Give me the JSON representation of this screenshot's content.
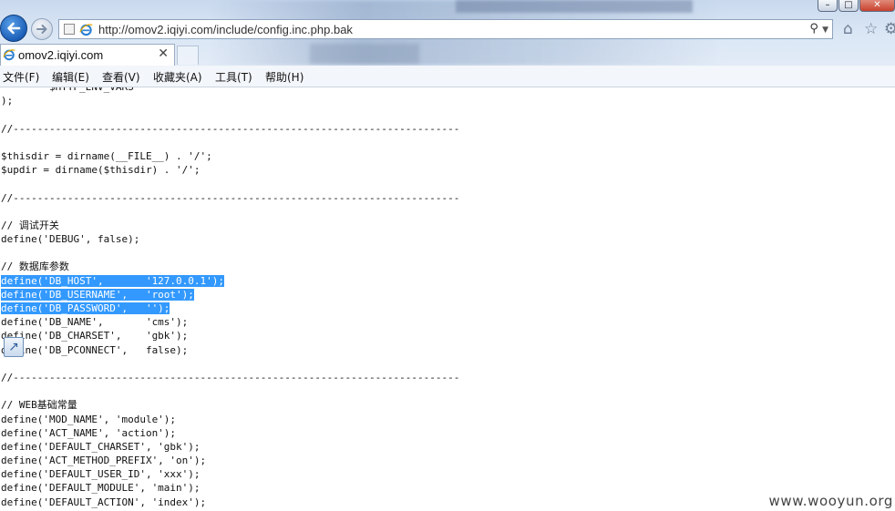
{
  "browser": {
    "url": "http://omov2.iqiyi.com/include/config.inc.php.bak",
    "tab_title": "omov2.iqiyi.com",
    "tab_close": "✕",
    "search_glyph": "⚲",
    "menu": [
      "文件(F)",
      "编辑(E)",
      "查看(V)",
      "收藏夹(A)",
      "工具(T)",
      "帮助(H)"
    ],
    "window_buttons": [
      "–",
      "□",
      "✕"
    ],
    "toolbar_icons": [
      "home-icon",
      "favorites-star-icon",
      "tools-gear-icon"
    ]
  },
  "code_lines": [
    {
      "text": "        $HTTP_ENV_VARS"
    },
    {
      "text": ");"
    },
    {
      "text": ""
    },
    {
      "text": "//--------------------------------------------------------------------------"
    },
    {
      "text": ""
    },
    {
      "text": "$thisdir = dirname(__FILE__) . '/';"
    },
    {
      "text": "$updir = dirname($thisdir) . '/';"
    },
    {
      "text": ""
    },
    {
      "text": "//--------------------------------------------------------------------------"
    },
    {
      "text": ""
    },
    {
      "text": "// 调试开关"
    },
    {
      "text": "define('DEBUG', false);"
    },
    {
      "text": ""
    },
    {
      "text": "// 数据库参数"
    },
    {
      "text": "define('DB_HOST',       '127.0.0.1');",
      "selected": true
    },
    {
      "text": "define('DB_USERNAME',   'root');",
      "selected": true
    },
    {
      "text": "define('DB_PASSWORD',   '');",
      "selected": true
    },
    {
      "text": "define('DB_NAME',       'cms');"
    },
    {
      "text": "define('DB_CHARSET',    'gbk');"
    },
    {
      "text": "define('DB_PCONNECT',   false);"
    },
    {
      "text": ""
    },
    {
      "text": "//--------------------------------------------------------------------------"
    },
    {
      "text": ""
    },
    {
      "text": "// WEB基础常量"
    },
    {
      "text": "define('MOD_NAME', 'module');"
    },
    {
      "text": "define('ACT_NAME', 'action');"
    },
    {
      "text": "define('DEFAULT_CHARSET', 'gbk');"
    },
    {
      "text": "define('ACT_METHOD_PREFIX', 'on');"
    },
    {
      "text": "define('DEFAULT_USER_ID', 'xxx');"
    },
    {
      "text": "define('DEFAULT_MODULE', 'main');"
    },
    {
      "text": "define('DEFAULT_ACTION', 'index');"
    }
  ],
  "watermark": "www.wooyun.org",
  "colors": {
    "selection": "#3399ff",
    "back_button": "#1b5fb8"
  }
}
